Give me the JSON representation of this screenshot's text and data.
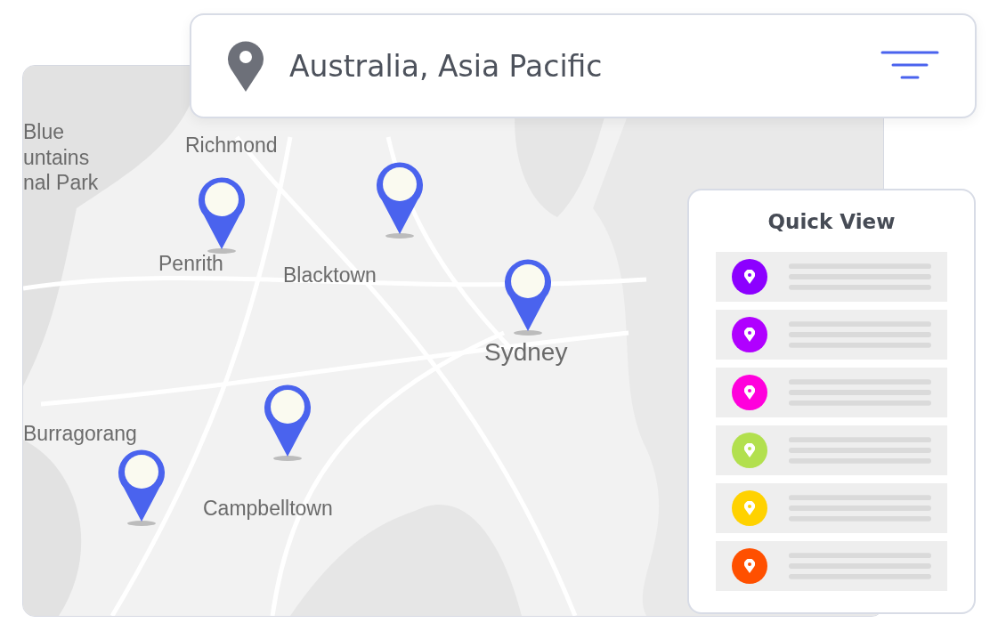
{
  "search": {
    "value": "Australia, Asia Pacific"
  },
  "map": {
    "labels": [
      {
        "text": "Blue",
        "kind": "region"
      },
      {
        "text": "untains",
        "kind": "region"
      },
      {
        "text": "nal Park",
        "kind": "region"
      },
      {
        "text": "Richmond",
        "kind": "suburb"
      },
      {
        "text": "Penrith",
        "kind": "suburb"
      },
      {
        "text": "Blacktown",
        "kind": "suburb"
      },
      {
        "text": "Sydney",
        "kind": "city"
      },
      {
        "text": "Burragorang",
        "kind": "region"
      },
      {
        "text": "Campbelltown",
        "kind": "suburb"
      }
    ]
  },
  "quick_view": {
    "title": "Quick View",
    "items": [
      {
        "color": "#8c00ff"
      },
      {
        "color": "#b000ff"
      },
      {
        "color": "#ff00dc"
      },
      {
        "color": "#b2e04e"
      },
      {
        "color": "#ffd200"
      },
      {
        "color": "#ff5000"
      }
    ]
  }
}
